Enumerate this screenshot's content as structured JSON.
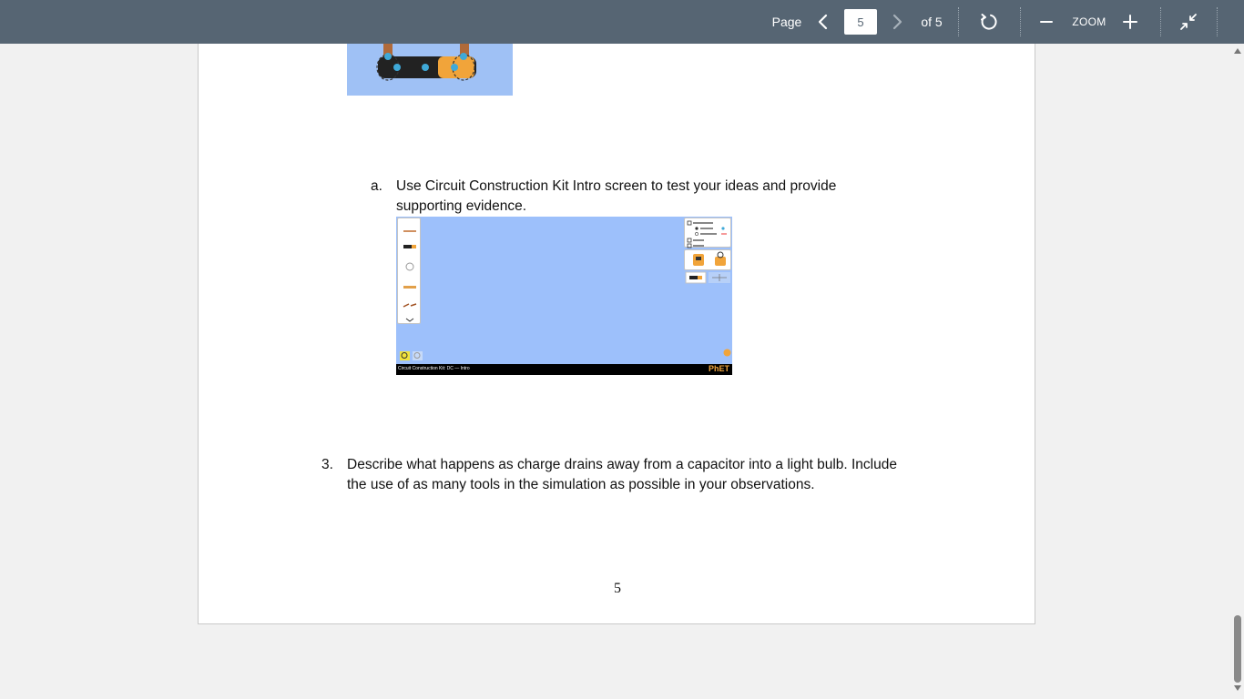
{
  "toolbar": {
    "page_label": "Page",
    "current_page": "5",
    "of_label": "of 5",
    "zoom_label": "ZOOM",
    "icons": {
      "prev": "chevron-left-icon",
      "next": "chevron-right-icon",
      "rotate": "rotate-icon",
      "zoom_out": "minus-icon",
      "zoom_in": "plus-icon",
      "collapse": "collapse-icon"
    }
  },
  "document": {
    "item_a_marker": "a.",
    "item_a_line1": "Use Circuit Construction Kit Intro screen to test your ideas and provide",
    "item_a_line2": "supporting evidence.",
    "item_3_marker": "3.",
    "item_3_line1": "Describe what happens as charge drains away from a capacitor into a light bulb. Include",
    "item_3_line2": "the use of as many tools in the simulation as possible in your observations.",
    "page_number": "5"
  },
  "sim_screenshot": {
    "title": "Circuit Construction Kit: DC — Intro",
    "logo": "PhET"
  },
  "colors": {
    "toolbar_bg": "#566573",
    "sim_bg": "#9dc0fb",
    "page_bg": "#ffffff"
  }
}
